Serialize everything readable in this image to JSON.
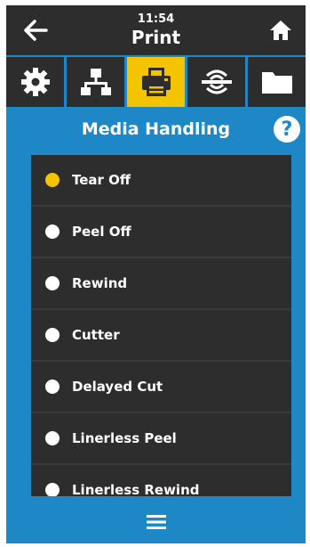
{
  "header": {
    "time": "11:54",
    "title": "Print"
  },
  "tabs": [
    {
      "name": "settings",
      "icon": "gear-icon"
    },
    {
      "name": "network",
      "icon": "network-icon"
    },
    {
      "name": "print",
      "icon": "printer-icon",
      "active": true
    },
    {
      "name": "connectivity",
      "icon": "wireless-icon"
    },
    {
      "name": "storage",
      "icon": "folder-icon"
    }
  ],
  "section": {
    "title": "Media Handling",
    "help_label": "?"
  },
  "options": [
    {
      "label": "Tear Off",
      "selected": true
    },
    {
      "label": "Peel Off",
      "selected": false
    },
    {
      "label": "Rewind",
      "selected": false
    },
    {
      "label": "Cutter",
      "selected": false
    },
    {
      "label": "Delayed Cut",
      "selected": false
    },
    {
      "label": "Linerless Peel",
      "selected": false
    },
    {
      "label": "Linerless Rewind",
      "selected": false
    }
  ],
  "colors": {
    "accent": "#f5c400",
    "background": "#1e88c6",
    "panel": "#2d2d2d"
  }
}
